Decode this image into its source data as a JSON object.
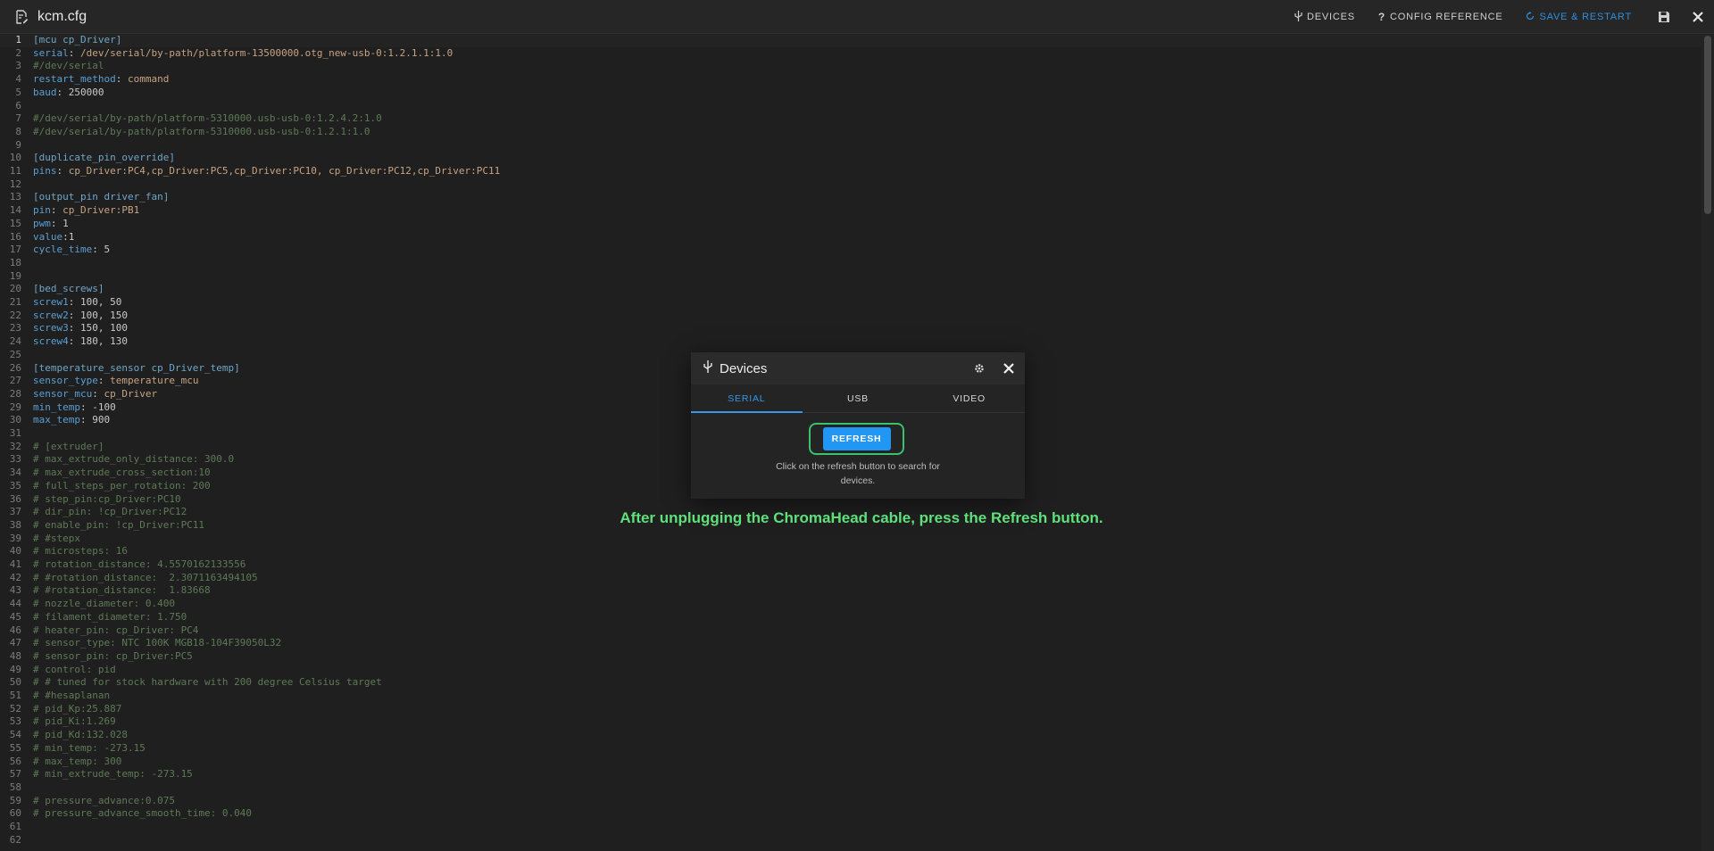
{
  "header": {
    "filename": "kcm.cfg",
    "actions": [
      {
        "label": "DEVICES",
        "icon": "usb-icon"
      },
      {
        "label": "CONFIG REFERENCE",
        "icon": "question-icon"
      },
      {
        "label": "SAVE & RESTART",
        "icon": "restart-icon"
      }
    ],
    "icons": {
      "file": "file-edit-icon",
      "save": "floppy-save-icon",
      "close": "close-icon"
    }
  },
  "editor": {
    "current_line": 1,
    "lines": [
      [
        [
          "sec",
          "[mcu cp_Driver]"
        ]
      ],
      [
        [
          "key",
          "serial"
        ],
        [
          "plain",
          ": "
        ],
        [
          "val",
          "/dev/serial/by-path/platform-13500000.otg_new-usb-0:1.2.1.1:1.0"
        ]
      ],
      [
        [
          "com",
          "#/dev/serial"
        ]
      ],
      [
        [
          "key",
          "restart_method"
        ],
        [
          "plain",
          ": "
        ],
        [
          "val",
          "command"
        ]
      ],
      [
        [
          "key",
          "baud"
        ],
        [
          "plain",
          ": "
        ],
        [
          "num",
          "250000"
        ]
      ],
      [],
      [
        [
          "com",
          "#/dev/serial/by-path/platform-5310000.usb-usb-0:1.2.4.2:1.0"
        ]
      ],
      [
        [
          "com",
          "#/dev/serial/by-path/platform-5310000.usb-usb-0:1.2.1:1.0"
        ]
      ],
      [],
      [
        [
          "sec",
          "[duplicate_pin_override]"
        ]
      ],
      [
        [
          "key",
          "pins"
        ],
        [
          "plain",
          ": "
        ],
        [
          "val",
          "cp_Driver:PC4,cp_Driver:PC5,cp_Driver:PC10, cp_Driver:PC12,cp_Driver:PC11"
        ]
      ],
      [],
      [
        [
          "sec",
          "[output_pin driver_fan]"
        ]
      ],
      [
        [
          "key",
          "pin"
        ],
        [
          "plain",
          ": "
        ],
        [
          "val",
          "cp_Driver:PB1"
        ]
      ],
      [
        [
          "key",
          "pwm"
        ],
        [
          "plain",
          ": "
        ],
        [
          "num",
          "1"
        ]
      ],
      [
        [
          "key",
          "value"
        ],
        [
          "plain",
          ":"
        ],
        [
          "num",
          "1"
        ]
      ],
      [
        [
          "key",
          "cycle_time"
        ],
        [
          "plain",
          ": "
        ],
        [
          "num",
          "5"
        ]
      ],
      [],
      [],
      [
        [
          "sec",
          "[bed_screws]"
        ]
      ],
      [
        [
          "key",
          "screw1"
        ],
        [
          "plain",
          ": "
        ],
        [
          "num",
          "100, 50"
        ]
      ],
      [
        [
          "key",
          "screw2"
        ],
        [
          "plain",
          ": "
        ],
        [
          "num",
          "100, 150"
        ]
      ],
      [
        [
          "key",
          "screw3"
        ],
        [
          "plain",
          ": "
        ],
        [
          "num",
          "150, 100"
        ]
      ],
      [
        [
          "key",
          "screw4"
        ],
        [
          "plain",
          ": "
        ],
        [
          "num",
          "180, 130"
        ]
      ],
      [],
      [
        [
          "sec",
          "[temperature_sensor cp_Driver_temp]"
        ]
      ],
      [
        [
          "key",
          "sensor_type"
        ],
        [
          "plain",
          ": "
        ],
        [
          "val",
          "temperature_mcu"
        ]
      ],
      [
        [
          "key",
          "sensor_mcu"
        ],
        [
          "plain",
          ": "
        ],
        [
          "val",
          "cp_Driver"
        ]
      ],
      [
        [
          "key",
          "min_temp"
        ],
        [
          "plain",
          ": "
        ],
        [
          "num",
          "-100"
        ]
      ],
      [
        [
          "key",
          "max_temp"
        ],
        [
          "plain",
          ": "
        ],
        [
          "num",
          "900"
        ]
      ],
      [],
      [
        [
          "com",
          "# [extruder]"
        ]
      ],
      [
        [
          "com",
          "# max_extrude_only_distance: 300.0"
        ]
      ],
      [
        [
          "com",
          "# max_extrude_cross_section:10"
        ]
      ],
      [
        [
          "com",
          "# full_steps_per_rotation: 200"
        ]
      ],
      [
        [
          "com",
          "# step_pin:cp_Driver:PC10"
        ]
      ],
      [
        [
          "com",
          "# dir_pin: !cp_Driver:PC12"
        ]
      ],
      [
        [
          "com",
          "# enable_pin: !cp_Driver:PC11"
        ]
      ],
      [
        [
          "com",
          "# #stepx"
        ]
      ],
      [
        [
          "com",
          "# microsteps: 16"
        ]
      ],
      [
        [
          "com",
          "# rotation_distance: 4.5570162133556"
        ]
      ],
      [
        [
          "com",
          "# #rotation_distance:  2.3071163494105"
        ]
      ],
      [
        [
          "com",
          "# #rotation_distance:  1.83668"
        ]
      ],
      [
        [
          "com",
          "# nozzle_diameter: 0.400"
        ]
      ],
      [
        [
          "com",
          "# filament_diameter: 1.750"
        ]
      ],
      [
        [
          "com",
          "# heater_pin: cp_Driver: PC4"
        ]
      ],
      [
        [
          "com",
          "# sensor_type: NTC 100K MGB18-104F39050L32"
        ]
      ],
      [
        [
          "com",
          "# sensor_pin: cp_Driver:PC5"
        ]
      ],
      [
        [
          "com",
          "# control: pid"
        ]
      ],
      [
        [
          "com",
          "# # tuned for stock hardware with 200 degree Celsius target"
        ]
      ],
      [
        [
          "com",
          "# #hesaplanan"
        ]
      ],
      [
        [
          "com",
          "# pid_Kp:25.887"
        ]
      ],
      [
        [
          "com",
          "# pid_Ki:1.269"
        ]
      ],
      [
        [
          "com",
          "# pid_Kd:132.028"
        ]
      ],
      [
        [
          "com",
          "# min_temp: -273.15"
        ]
      ],
      [
        [
          "com",
          "# max_temp: 300"
        ]
      ],
      [
        [
          "com",
          "# min_extrude_temp: -273.15"
        ]
      ],
      [],
      [
        [
          "com",
          "# pressure_advance:0.075"
        ]
      ],
      [
        [
          "com",
          "# pressure_advance_smooth_time: 0.040"
        ]
      ],
      [],
      []
    ]
  },
  "dialog": {
    "title": "Devices",
    "icons": {
      "title": "usb-icon",
      "settings": "gear-icon",
      "close": "close-icon"
    },
    "tabs": [
      "SERIAL",
      "USB",
      "VIDEO"
    ],
    "active_tab": "SERIAL",
    "refresh_label": "REFRESH",
    "hint": "Click on the refresh button to search for devices."
  },
  "caption": "After unplugging the ChromaHead cable, press the Refresh button.",
  "colors": {
    "accent": "#2196f3",
    "caption": "#5ee07a",
    "highlight_border": "#39c16b"
  }
}
